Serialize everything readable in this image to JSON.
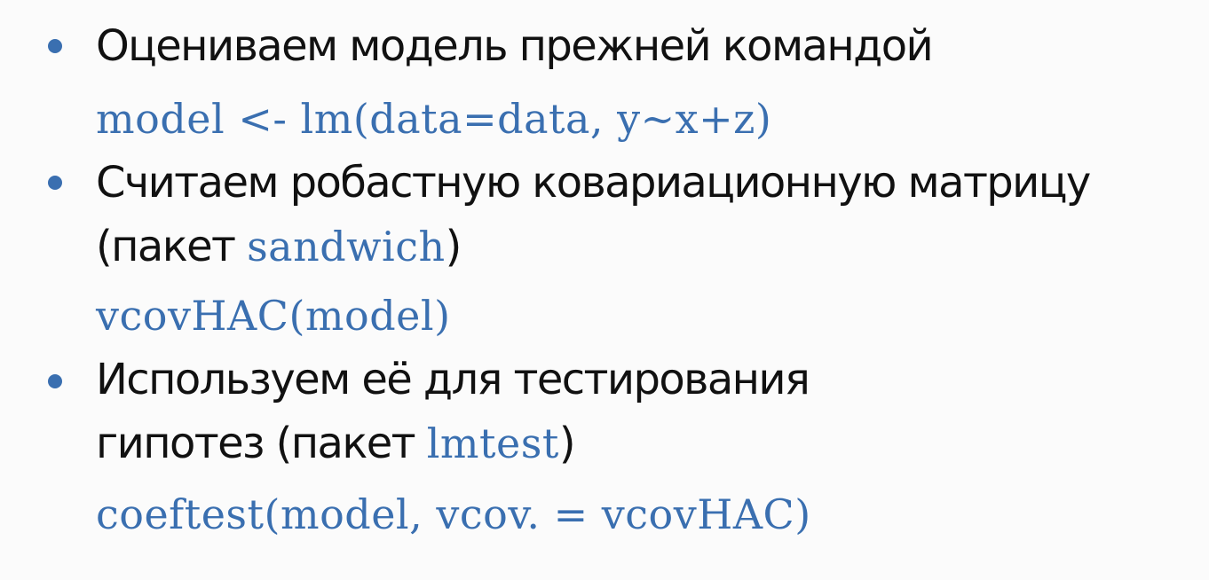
{
  "slide": {
    "items": [
      {
        "text": "Оцениваем модель прежней командой",
        "code": "model <- lm(data=data, y~x+z)"
      },
      {
        "text": "Считаем робастную ковариационную матрицу",
        "text2_prefix": "(пакет ",
        "text2_code": "sandwich",
        "text2_suffix": ")",
        "code": "vcovHAC(model)"
      },
      {
        "text": "Используем её для тестирования",
        "text2_prefix": "гипотез (пакет ",
        "text2_code": "lmtest",
        "text2_suffix": ")",
        "code": "coeftest(model, vcov. = vcovHAC)"
      }
    ]
  },
  "colors": {
    "accent": "#3a6fb0",
    "text": "#111111",
    "background": "#fbfbfb"
  }
}
